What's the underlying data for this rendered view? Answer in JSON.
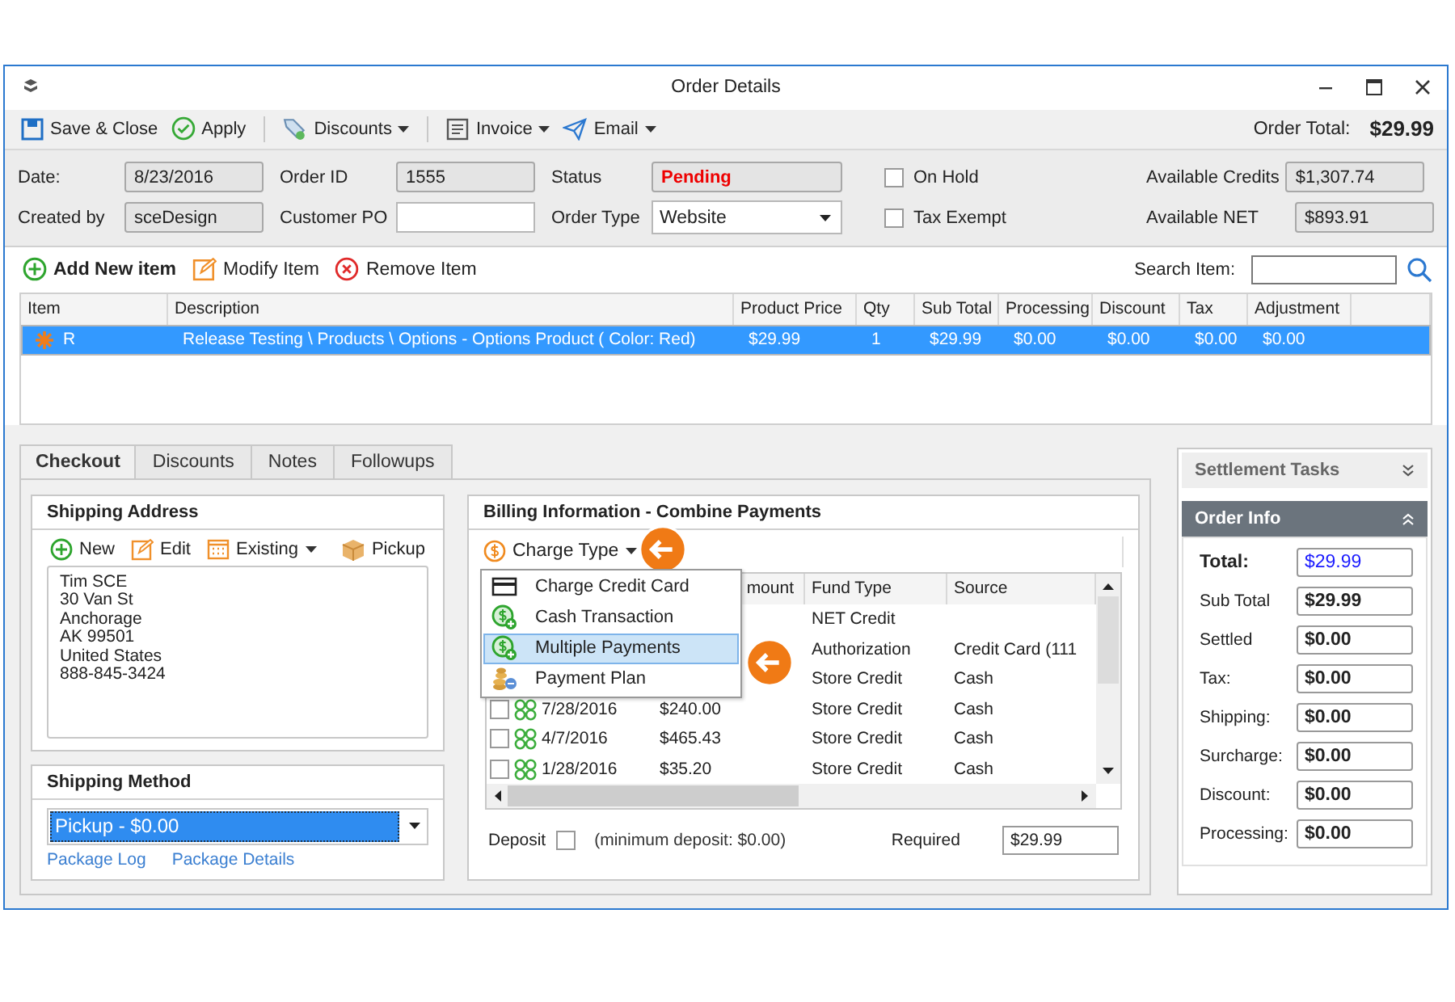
{
  "window": {
    "title": "Order Details"
  },
  "toolbar": {
    "buttons": [
      {
        "label": "Save & Close",
        "kind": "save",
        "dropdown": false
      },
      {
        "label": "Apply",
        "kind": "apply",
        "dropdown": false
      },
      {
        "label": "Discounts",
        "kind": "discount",
        "dropdown": true
      },
      {
        "label": "Invoice",
        "kind": "invoice",
        "dropdown": true
      },
      {
        "label": "Email",
        "kind": "email",
        "dropdown": true
      }
    ],
    "total_label": "Order Total:",
    "total": "$29.99"
  },
  "header": {
    "date": {
      "label": "Date:",
      "value": "8/23/2016"
    },
    "created_by": {
      "label": "Created by",
      "value": "sceDesign"
    },
    "order_id": {
      "label": "Order ID",
      "value": "1555"
    },
    "customer_po": {
      "label": "Customer PO"
    },
    "status": {
      "label": "Status",
      "value": "Pending"
    },
    "order_type": {
      "label": "Order Type",
      "value": "Website"
    },
    "checks": [
      {
        "label": "On Hold",
        "checked": false
      },
      {
        "label": "Tax Exempt",
        "checked": false
      }
    ],
    "credits": {
      "label": "Available Credits",
      "value": "$1,307.74"
    },
    "net": {
      "label": "Available NET",
      "value": "$893.91"
    }
  },
  "item_actions": [
    {
      "label": "Add New item",
      "kind": "add"
    },
    {
      "label": "Modify Item",
      "kind": "modify"
    },
    {
      "label": "Remove Item",
      "kind": "remove"
    }
  ],
  "search": {
    "label": "Search Item:"
  },
  "items_table": {
    "columns": [
      "Item",
      "Description",
      "Product Price",
      "Qty",
      "Sub Total",
      "Processing",
      "Discount",
      "Tax",
      "Adjustment"
    ],
    "rows": [
      {
        "selected": true,
        "cells": [
          "R",
          "Release Testing \\ Products \\ Options - Options Product ( Color: Red)",
          "$29.99",
          "1",
          "$29.99",
          "$0.00",
          "$0.00",
          "$0.00",
          "$0.00"
        ]
      }
    ]
  },
  "tabs": [
    {
      "label": "Checkout",
      "selected": true
    },
    {
      "label": "Discounts",
      "selected": false
    },
    {
      "label": "Notes",
      "selected": false
    },
    {
      "label": "Followups",
      "selected": false
    }
  ],
  "shipping_address": {
    "title": "Shipping Address",
    "actions": [
      {
        "label": "New",
        "kind": "new",
        "dropdown": false
      },
      {
        "label": "Edit",
        "kind": "edit",
        "dropdown": false
      },
      {
        "label": "Existing",
        "kind": "existing",
        "dropdown": true
      },
      {
        "label": "Pickup",
        "kind": "pickup",
        "dropdown": false
      }
    ],
    "lines": [
      "Tim SCE",
      "30 Van St",
      "Anchorage",
      "AK 99501",
      "United States",
      "888-845-3424"
    ]
  },
  "shipping_method": {
    "title": "Shipping Method",
    "value": "Pickup - $0.00",
    "links": [
      "Package Log",
      "Package Details"
    ]
  },
  "billing": {
    "title": "Billing Information - Combine Payments",
    "charge_type": "Charge Type",
    "menu": [
      {
        "label": "Charge Credit Card",
        "kind": "card",
        "selected": false
      },
      {
        "label": "Cash Transaction",
        "kind": "cash",
        "selected": false
      },
      {
        "label": "Multiple Payments",
        "kind": "cash",
        "selected": true
      },
      {
        "label": "Payment Plan",
        "kind": "plan",
        "selected": false
      }
    ],
    "columns": [
      "mount",
      "Fund Type",
      "Source"
    ],
    "rows": [
      {
        "fund_type": "NET Credit"
      },
      {
        "fund_type": "Authorization",
        "source": "Credit Card (111"
      },
      {
        "fund_type": "Store Credit",
        "source": "Cash"
      },
      {
        "checked": false,
        "date": "7/28/2016",
        "amount": "$240.00",
        "fund_type": "Store Credit",
        "source": "Cash"
      },
      {
        "checked": false,
        "date": "4/7/2016",
        "amount": "$465.43",
        "fund_type": "Store Credit",
        "source": "Cash"
      },
      {
        "checked": false,
        "date": "1/28/2016",
        "amount": "$35.20",
        "fund_type": "Store Credit",
        "source": "Cash"
      }
    ],
    "deposit_label": "Deposit",
    "deposit_checked": false,
    "deposit_note": "(minimum deposit: $0.00)",
    "required_label": "Required",
    "required_value": "$29.99"
  },
  "side": {
    "settlement_title": "Settlement Tasks",
    "order_info_title": "Order Info",
    "fields": [
      {
        "label": "Total:",
        "value": "$29.99",
        "kind": "total"
      },
      {
        "label": "Sub Total",
        "value": "$29.99",
        "kind": "normal"
      },
      {
        "label": "Settled",
        "value": "$0.00",
        "kind": "normal"
      },
      {
        "label": "Tax:",
        "value": "$0.00",
        "kind": "normal"
      },
      {
        "label": "Shipping:",
        "value": "$0.00",
        "kind": "normal"
      },
      {
        "label": "Surcharge:",
        "value": "$0.00",
        "kind": "normal"
      },
      {
        "label": "Discount:",
        "value": "$0.00",
        "kind": "normal"
      },
      {
        "label": "Processing:",
        "value": "$0.00",
        "kind": "normal"
      }
    ]
  }
}
